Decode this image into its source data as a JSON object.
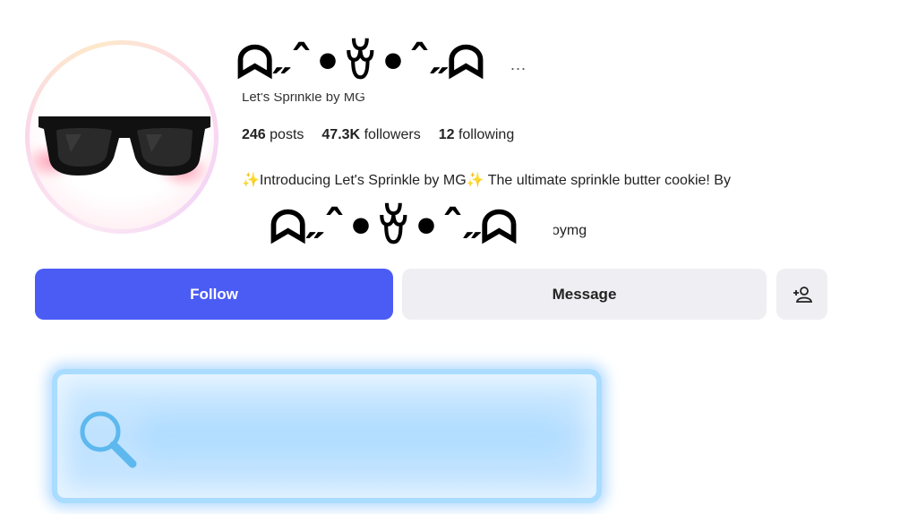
{
  "profile": {
    "display_name": "ᗣ˶ˆ•ꈊ•ˆ˶ᗣ",
    "more_dots": "...",
    "username": "Let's Sprinkle by MG",
    "stats": {
      "posts_count": "246",
      "posts_label": "posts",
      "followers_count": "47.3K",
      "followers_label": "followers",
      "following_count": "12",
      "following_label": "following"
    },
    "bio": "✨Introducing Let's Sprinkle by MG✨ The ultimate sprinkle butter cookie! By",
    "bio_kaomoji": "ᗣ˶ˆ•ꈊ•ˆ˶ᗣ",
    "bio_handle": "oymg"
  },
  "actions": {
    "follow_label": "Follow",
    "message_label": "Message",
    "add_user_label": "+👤"
  },
  "colors": {
    "follow_bg": "#4b5cf5",
    "secondary_bg": "#efeff3",
    "search_bg": "#c8e6ff"
  },
  "icons": {
    "avatar": "sunglasses-icon",
    "search": "search-icon",
    "add_user": "add-user-icon"
  }
}
